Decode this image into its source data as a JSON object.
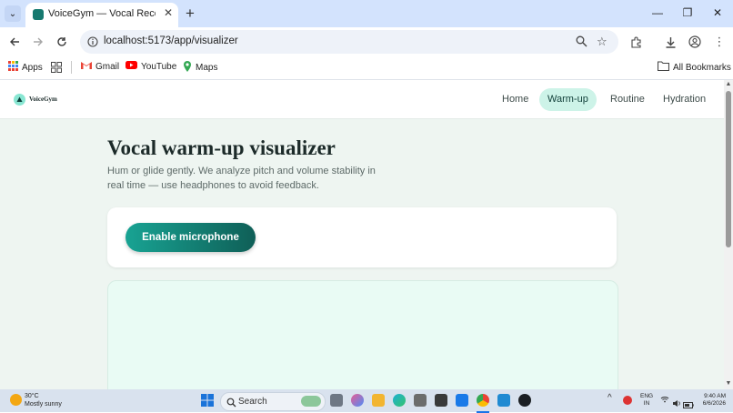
{
  "browser": {
    "tab_title": "VoiceGym — Vocal Recovery St",
    "tab_close": "✕",
    "new_tab": "+",
    "url": "localhost:5173/app/visualizer",
    "window_controls": {
      "minimize": "—",
      "restore": "❐",
      "close": "✕"
    }
  },
  "bookmarks": {
    "items": [
      {
        "label": "Apps",
        "icon": "apps-grid-icon"
      },
      {
        "label": "Gmail",
        "icon": "gmail-icon"
      },
      {
        "label": "YouTube",
        "icon": "youtube-icon"
      },
      {
        "label": "Maps",
        "icon": "maps-icon"
      }
    ],
    "all_bookmarks": "All Bookmarks"
  },
  "site": {
    "logo": "VoiceGym",
    "nav": [
      "Home",
      "Warm-up",
      "Routine",
      "Hydration"
    ],
    "active_nav": "Warm-up",
    "title": "Vocal warm-up visualizer",
    "subtitle": "Hum or glide gently. We analyze pitch and volume stability in real time — use headphones to avoid feedback.",
    "enable_button": "Enable microphone"
  },
  "taskbar": {
    "temp": "30°C",
    "weather": "Mostly sunny",
    "search": "Search",
    "lang_line1": "ENG",
    "lang_line2": "IN",
    "time": "9:40 AM",
    "date": "6/6/2026"
  },
  "colors": {
    "accent": "#18a393",
    "accent_dark": "#0f5f57",
    "nav_active_bg": "#cdf3e8",
    "page_bg": "#eef5f1"
  }
}
